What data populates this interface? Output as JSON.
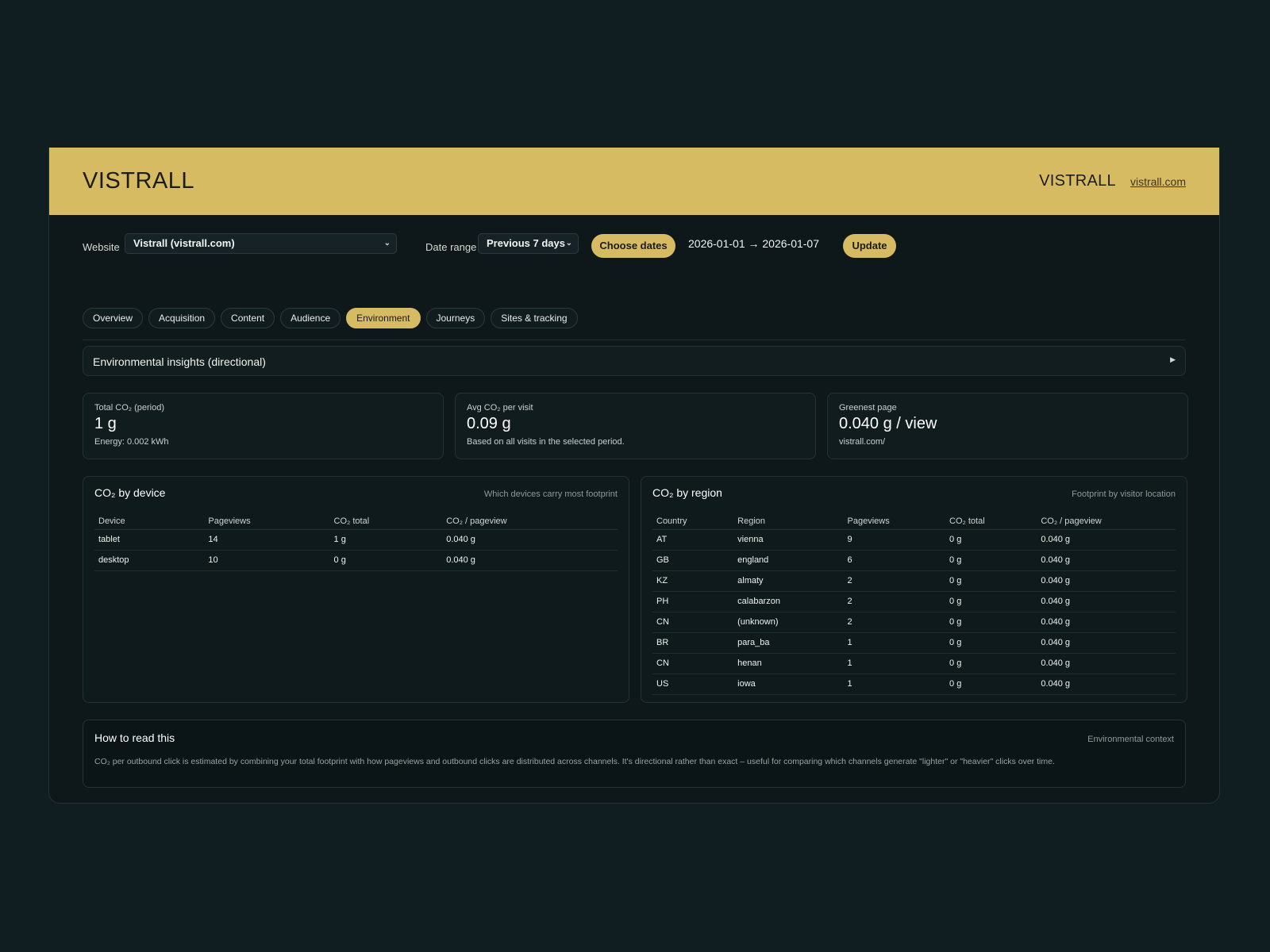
{
  "header": {
    "brand": "VISTRALL",
    "brand_right": "VISTRALL",
    "site_link": "vistrall.com"
  },
  "controls": {
    "website_label": "Website",
    "website_value": "Vistrall (vistrall.com)",
    "date_range_label": "Date range",
    "date_range_value": "Previous 7 days",
    "choose_dates": "Choose dates",
    "range_text": "2026-01-01 → 2026-01-07",
    "update": "Update"
  },
  "tabs": [
    {
      "label": "Overview",
      "active": false
    },
    {
      "label": "Acquisition",
      "active": false
    },
    {
      "label": "Content",
      "active": false
    },
    {
      "label": "Audience",
      "active": false
    },
    {
      "label": "Environment",
      "active": true
    },
    {
      "label": "Journeys",
      "active": false
    },
    {
      "label": "Sites & tracking",
      "active": false
    }
  ],
  "accordion": {
    "title": "Environmental insights (directional)"
  },
  "kpis": [
    {
      "label": "Total CO₂ (period)",
      "value": "1 g",
      "sub": "Energy: 0.002 kWh"
    },
    {
      "label": "Avg CO₂ per visit",
      "value": "0.09 g",
      "sub": "Based on all visits in the selected period."
    },
    {
      "label": "Greenest page",
      "value": "0.040 g / view",
      "sub": "vistrall.com/"
    }
  ],
  "device_table": {
    "title": "CO₂ by device",
    "hint": "Which devices carry most footprint",
    "columns": [
      "Device",
      "Pageviews",
      "CO₂ total",
      "CO₂ / pageview"
    ],
    "rows": [
      [
        "tablet",
        "14",
        "1 g",
        "0.040 g"
      ],
      [
        "desktop",
        "10",
        "0 g",
        "0.040 g"
      ]
    ]
  },
  "region_table": {
    "title": "CO₂ by region",
    "hint": "Footprint by visitor location",
    "columns": [
      "Country",
      "Region",
      "Pageviews",
      "CO₂ total",
      "CO₂ / pageview"
    ],
    "rows": [
      [
        "AT",
        "vienna",
        "9",
        "0 g",
        "0.040 g"
      ],
      [
        "GB",
        "england",
        "6",
        "0 g",
        "0.040 g"
      ],
      [
        "KZ",
        "almaty",
        "2",
        "0 g",
        "0.040 g"
      ],
      [
        "PH",
        "calabarzon",
        "2",
        "0 g",
        "0.040 g"
      ],
      [
        "CN",
        "(unknown)",
        "2",
        "0 g",
        "0.040 g"
      ],
      [
        "BR",
        "para_ba",
        "1",
        "0 g",
        "0.040 g"
      ],
      [
        "CN",
        "henan",
        "1",
        "0 g",
        "0.040 g"
      ],
      [
        "US",
        "iowa",
        "1",
        "0 g",
        "0.040 g"
      ]
    ]
  },
  "howto": {
    "title": "How to read this",
    "hint": "Environmental context",
    "text": "CO₂ per outbound click is estimated by combining your total footprint with how pageviews and outbound clicks are distributed across channels. It's directional rather than exact – useful for comparing which channels generate \"lighter\" or \"heavier\" clicks over time."
  },
  "colors": {
    "accent": "#d6bb63",
    "background": "#101e22",
    "panel": "#0e181b"
  }
}
